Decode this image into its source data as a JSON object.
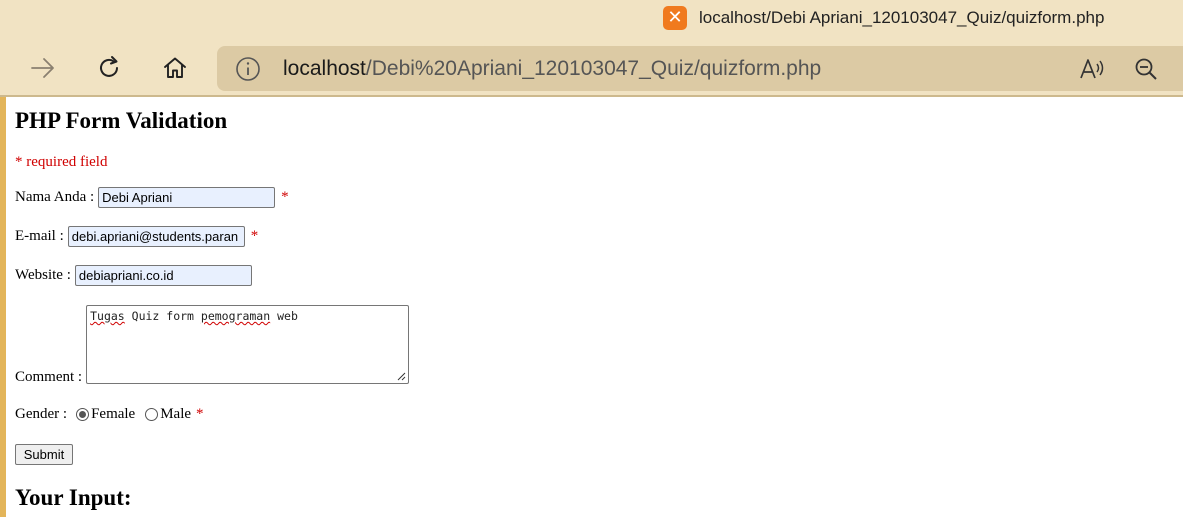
{
  "browser": {
    "tab_title": "localhost/Debi Apriani_120103047_Quiz/quizform.php",
    "url_host": "localhost",
    "url_path": "/Debi%20Apriani_120103047_Quiz/quizform.php",
    "icons": [
      "xampp-icon",
      "forward-icon",
      "refresh-icon",
      "home-icon",
      "info-icon",
      "read-aloud-icon",
      "zoom-out-icon"
    ]
  },
  "page": {
    "heading": "PHP Form Validation",
    "required_note": "* required field",
    "name_label": "Nama Anda :",
    "name_value": "Debi Apriani",
    "email_label": "E-mail :",
    "email_value": "debi.apriani@students.paran",
    "website_label": "Website :",
    "website_value": "debiapriani.co.id",
    "comment_label": "Comment :",
    "comment_words": [
      "Tugas",
      "Quiz form",
      "pemograman",
      "web"
    ],
    "gender_label": "Gender :",
    "gender_options": [
      "Female",
      "Male"
    ],
    "gender_selected": "Female",
    "required_star": "*",
    "submit_label": "Submit",
    "result_heading": "Your Input:"
  },
  "colors": {
    "required": "#d00000",
    "chrome": "#f1e3c3",
    "address_bar": "#dccaa4",
    "autofill": "#e8f0fe"
  }
}
